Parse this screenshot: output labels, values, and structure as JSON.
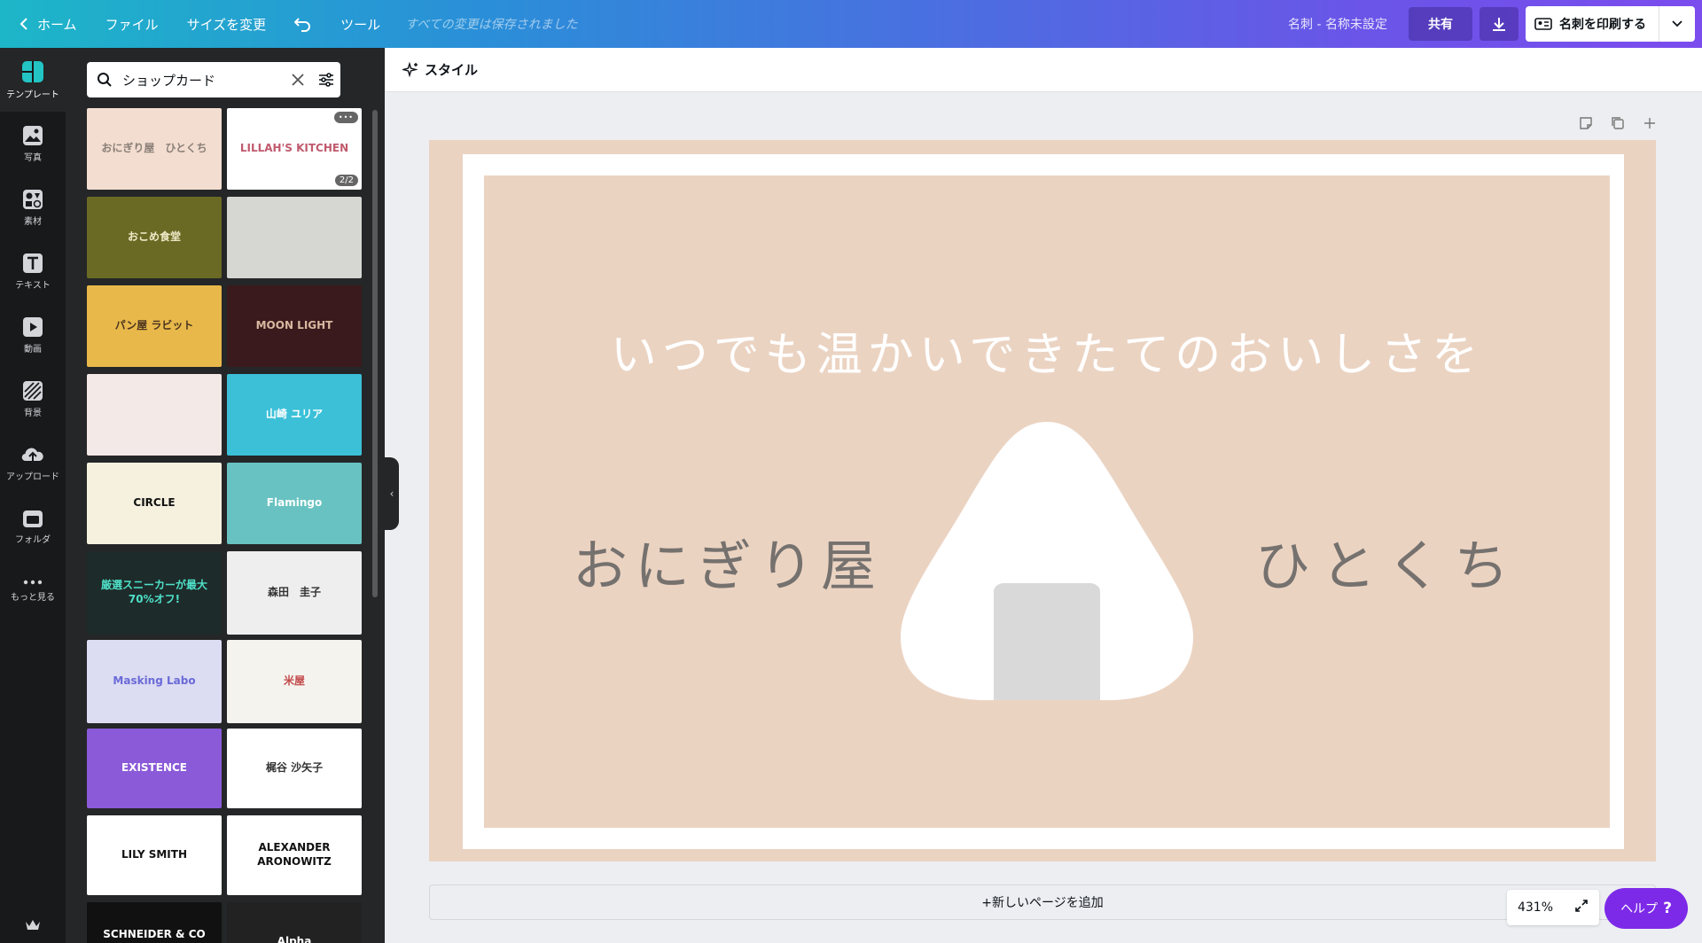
{
  "topbar": {
    "home": "ホーム",
    "file": "ファイル",
    "resize": "サイズを変更",
    "tools": "ツール",
    "saved_status": "すべての変更は保存されました",
    "doc_name": "名刺 - 名称未設定",
    "share": "共有",
    "print": "名刺を印刷する"
  },
  "rail": [
    {
      "label": "テンプレート",
      "icon": "templates-icon"
    },
    {
      "label": "写真",
      "icon": "photo-icon"
    },
    {
      "label": "素材",
      "icon": "elements-icon"
    },
    {
      "label": "テキスト",
      "icon": "text-icon"
    },
    {
      "label": "動画",
      "icon": "video-icon"
    },
    {
      "label": "背景",
      "icon": "background-icon"
    },
    {
      "label": "アップロード",
      "icon": "upload-icon"
    },
    {
      "label": "フォルダ",
      "icon": "folder-icon"
    },
    {
      "label": "もっと見る",
      "icon": "more-icon"
    }
  ],
  "search": {
    "value": "ショップカード"
  },
  "templates": [
    {
      "bg": "#f2ddd0",
      "title": "おにぎり屋　ひとくち",
      "fg": "#8a7f77"
    },
    {
      "bg": "#ffffff",
      "title": "LILLAH'S KITCHEN",
      "fg": "#c05a6e",
      "badge": "2/2"
    },
    {
      "bg": "#6b6a25",
      "title": "おこめ食堂",
      "fg": "#f1e9c8"
    },
    {
      "bg": "#d6d6d2",
      "title": "",
      "fg": "#e85a8a"
    },
    {
      "bg": "#e8b94a",
      "title": "パン屋 ラビット",
      "fg": "#4a3320"
    },
    {
      "bg": "#3a1a1d",
      "title": "MOON LIGHT",
      "fg": "#d9b9a0"
    },
    {
      "bg": "#f3e9e6",
      "title": "",
      "fg": "#e7b9ae"
    },
    {
      "bg": "#3bc0d8",
      "title": "山崎 ユリア",
      "fg": "#ffffff"
    },
    {
      "bg": "#f6f1df",
      "title": "CIRCLE",
      "fg": "#111111"
    },
    {
      "bg": "#69c2c2",
      "title": "Flamingo",
      "fg": "#ffffff"
    },
    {
      "bg": "#1d2b2a",
      "title": "厳選スニーカーが最大70%オフ!",
      "fg": "#4fe0c8"
    },
    {
      "bg": "#eeeeee",
      "title": "森田　圭子",
      "fg": "#333333"
    },
    {
      "bg": "#dcdcf2",
      "title": "Masking Labo",
      "fg": "#6a6ad8"
    },
    {
      "bg": "#f5f3ee",
      "title": "米屋",
      "fg": "#c24a4a"
    },
    {
      "bg": "#8a5ad8",
      "title": "EXISTENCE",
      "fg": "#ffffff"
    },
    {
      "bg": "#ffffff",
      "title": "梶谷 沙矢子",
      "fg": "#333333"
    },
    {
      "bg": "#ffffff",
      "title": "LILY SMITH",
      "fg": "#111111"
    },
    {
      "bg": "#ffffff",
      "title": "ALEXANDER ARONOWITZ",
      "fg": "#111111"
    },
    {
      "bg": "#111111",
      "title": "SCHNEIDER & CO INTERIORS",
      "fg": "#ffffff"
    },
    {
      "bg": "#222222",
      "title": "Alpha",
      "fg": "#ffffff"
    }
  ],
  "styles_button": "スタイル",
  "canvas": {
    "tagline": "いつでも温かいできたてのおいしさを",
    "shop_left": "おにぎり屋",
    "shop_right": "ひとくち",
    "bg_color": "#ebd3c2"
  },
  "add_page": "+新しいページを追加",
  "zoom": "431%",
  "help": "ヘルプ"
}
